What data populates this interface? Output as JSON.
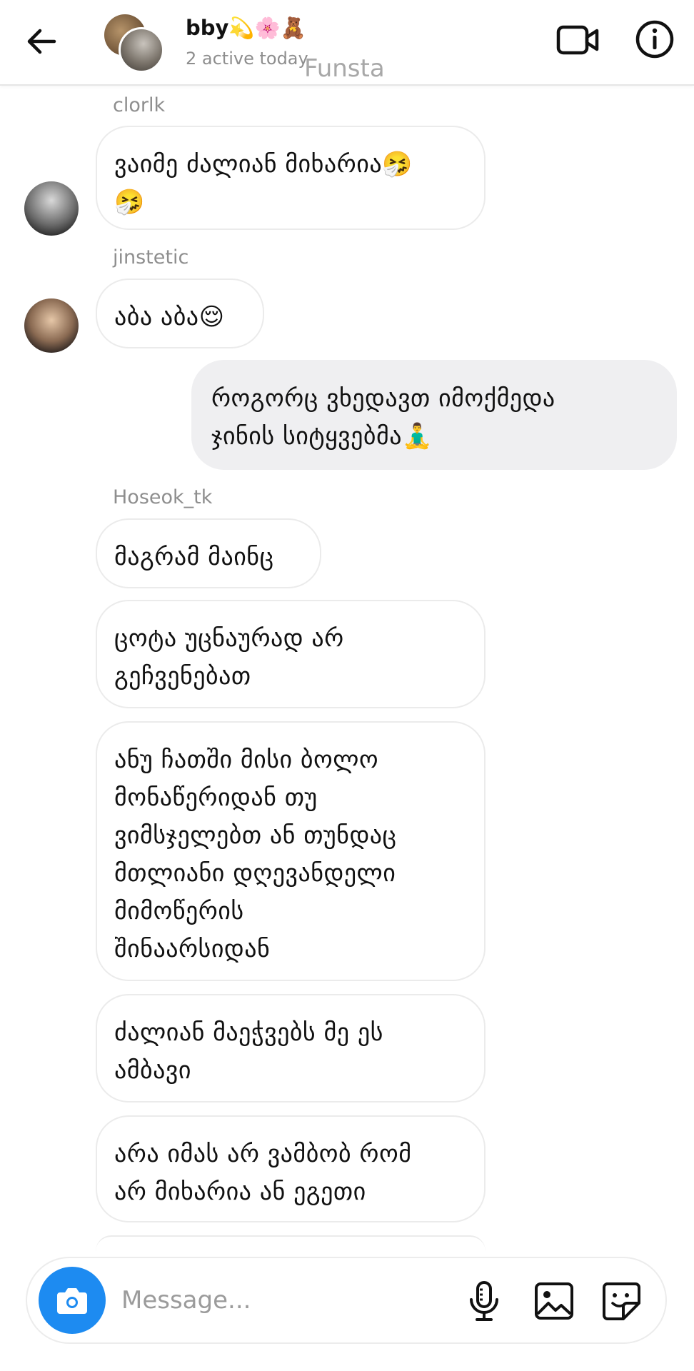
{
  "header": {
    "chat_name": "bby💫🌸🧸",
    "status": "2 active today",
    "watermark": "Funsta"
  },
  "messages": [
    {
      "sender": "clorlk",
      "lines": [
        "ვაიმე ძალიან მიხარია🤧",
        "🤧"
      ]
    },
    {
      "sender": "jinstetic",
      "lines": [
        "აბა აბა😌"
      ]
    },
    {
      "sender": "",
      "mine": true,
      "lines": [
        "როგორც ვხედავთ იმოქმედა",
        "ჯინის სიტყვებმა🧘‍♂️"
      ]
    },
    {
      "sender": "Hoseok_tk",
      "lines": [
        "მაგრამ მაინც"
      ]
    },
    {
      "sender": "",
      "lines": [
        "ცოტა უცნაურად არ",
        "გეჩვენებათ"
      ]
    },
    {
      "sender": "",
      "lines": [
        "ანუ ჩათში მისი ბოლო",
        "მონაწერიდან თუ",
        "ვიმსჯელებთ ან თუნდაც",
        "მთლიანი დღევანდელი",
        "მიმოწერის",
        "შინაარსიდან"
      ]
    },
    {
      "sender": "",
      "lines": [
        "ძალიან მაეჭვებს მე ეს",
        "ამბავი"
      ]
    },
    {
      "sender": "",
      "lines": [
        "არა იმას არ ვამბობ რომ",
        "არ მიხარია ან ეგეთი"
      ]
    }
  ],
  "composer": {
    "placeholder": "Message..."
  },
  "icons": {
    "back": "arrow-left-icon",
    "video": "video-camera-icon",
    "info": "info-icon",
    "camera": "camera-icon",
    "mic": "microphone-icon",
    "gallery": "image-icon",
    "sticker": "sticker-icon"
  },
  "colors": {
    "accent": "#1d8bf1",
    "my_bubble": "#efeff1",
    "secondary_text": "#8e8e8e"
  }
}
